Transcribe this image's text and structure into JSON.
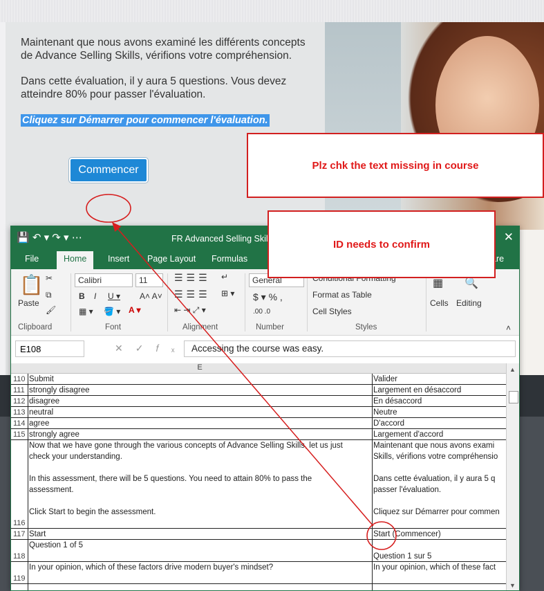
{
  "course": {
    "intro_1": "Maintenant que nous avons examiné les différents concepts de Advance Selling Skills, vérifions votre compréhension.",
    "intro_2": "Dans cette évaluation, il y aura 5 questions. Vous devez atteindre 80% pour passer l'évaluation.",
    "cta": "Cliquez sur Démarrer pour commencer l'évaluation.",
    "start_button": "Commencer"
  },
  "callouts": {
    "text_missing": "Plz chk the text missing in course",
    "id_confirm": "ID needs to confirm"
  },
  "excel": {
    "title": "FR Advanced Selling Skills_",
    "tabs": [
      "File",
      "Home",
      "Insert",
      "Page Layout",
      "Formulas",
      "are"
    ],
    "ribbon": {
      "paste": "Paste",
      "clipboard": "Clipboard",
      "font_name": "Calibri",
      "font_size": "11",
      "font": "Font",
      "alignment": "Alignment",
      "number_format": "General",
      "number": "Number",
      "conditional_formatting": "Conditional Formatting",
      "format_as_table": "Format as Table",
      "cell_styles": "Cell Styles",
      "styles": "Styles",
      "cells": "Cells",
      "editing": "Editing"
    },
    "name_box": "E108",
    "formula": "Accessing the course was easy.",
    "column_header": "E",
    "rows": [
      {
        "n": "110",
        "e": "Submit",
        "f": "Valider"
      },
      {
        "n": "111",
        "e": "strongly disagree",
        "f": "Largement en désaccord"
      },
      {
        "n": "112",
        "e": "disagree",
        "f": "En désaccord"
      },
      {
        "n": "113",
        "e": "neutral",
        "f": "Neutre"
      },
      {
        "n": "114",
        "e": "agree",
        "f": "D'accord"
      },
      {
        "n": "115",
        "e": "strongly agree",
        "f": "Largement d'accord"
      },
      {
        "n": "116",
        "e": "Now that we have gone through the various concepts of Advance Selling Skills, let us just\ncheck your understanding.\n\nIn this assessment, there will be 5 questions. You need to attain 80% to pass the\nassessment.\n\nClick Start to begin the assessment.",
        "f": "Maintenant que nous avons exami\nSkills, vérifions votre compréhensio\n\nDans cette évaluation, il y aura 5 q\npasser l'évaluation.\n\nCliquez sur Démarrer pour commen"
      },
      {
        "n": "117",
        "e": "Start",
        "f": "Start (Commencer)"
      },
      {
        "n": "118",
        "e": "Question 1 of 5",
        "f": "\nQuestion 1 sur 5"
      },
      {
        "n": "119",
        "e": "In your opinion, which of these factors drive modern buyer's mindset?",
        "f": "In your opinion, which of these fact"
      }
    ]
  }
}
